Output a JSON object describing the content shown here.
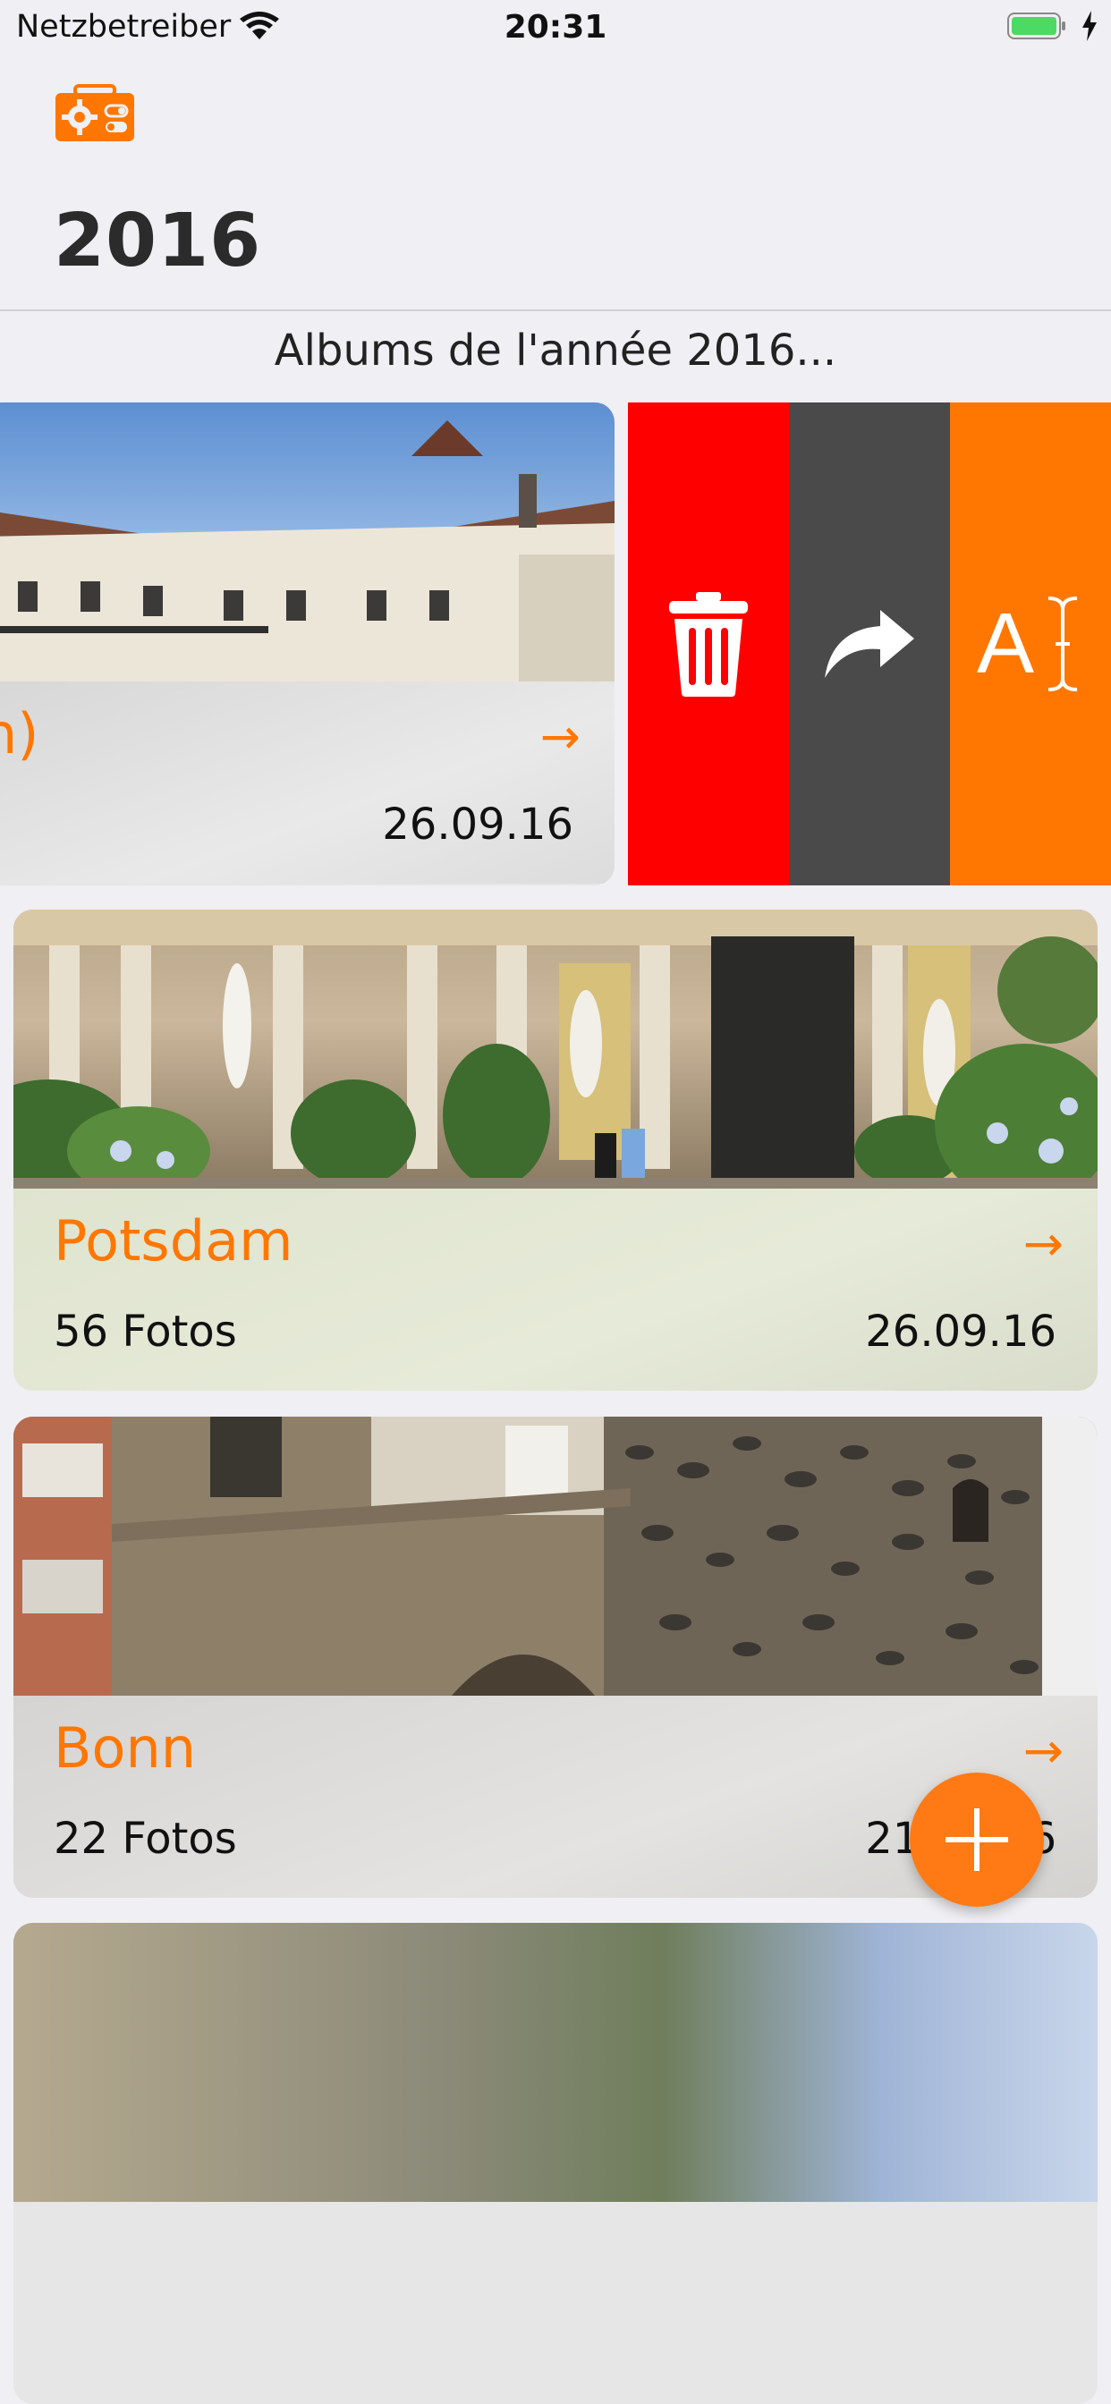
{
  "status_bar": {
    "carrier": "Netzbetreiber",
    "time": "20:31",
    "wifi_icon": "wifi-icon",
    "battery_icon": "battery-charging-icon"
  },
  "nav": {
    "settings_icon": "settings-toggle-icon",
    "title": "2016"
  },
  "subtitle": "Albums de l'année 2016...",
  "colors": {
    "accent": "#ff7700",
    "delete": "#ff0000",
    "share": "#4a4a4a",
    "rename": "#ff7700",
    "background": "#f0eff4"
  },
  "albums": [
    {
      "name": "n)",
      "count": "",
      "date": "26.09.16",
      "arrow": "→",
      "swiped": true
    },
    {
      "name": "Potsdam",
      "count": "56 Fotos",
      "date": "26.09.16",
      "arrow": "→"
    },
    {
      "name": "Bonn",
      "count": "22 Fotos",
      "date": "21.08.16",
      "arrow": "→"
    }
  ],
  "swipe_actions": [
    {
      "name": "delete",
      "icon": "trash-icon"
    },
    {
      "name": "share",
      "icon": "share-arrow-icon"
    },
    {
      "name": "rename",
      "icon": "rename-text-cursor-icon",
      "glyph": "A"
    }
  ],
  "fab": {
    "icon": "plus-icon"
  }
}
